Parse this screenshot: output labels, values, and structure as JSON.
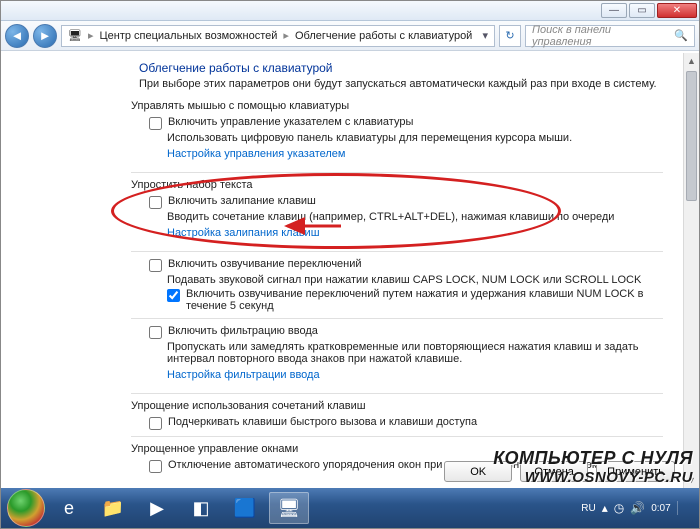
{
  "titlebar": {
    "min": "—",
    "max": "▭",
    "close": "✕"
  },
  "nav": {
    "back": "◄",
    "fwd": "►",
    "refresh": "↻",
    "crumb1": "Центр специальных возможностей",
    "crumb2": "Облегчение работы с клавиатурой",
    "search_placeholder": "Поиск в панели управления"
  },
  "page": {
    "title": "Облегчение работы с клавиатурой",
    "desc": "При выборе этих параметров они будут запускаться автоматически каждый раз при входе в систему."
  },
  "sec_mouse": {
    "head": "Управлять мышью с помощью клавиатуры",
    "chk1": "Включить управление указателем с клавиатуры",
    "note": "Использовать цифровую панель клавиатуры для перемещения курсора мыши.",
    "link": "Настройка управления указателем"
  },
  "sec_typing": {
    "head": "Упростить набор текста",
    "sticky_chk": "Включить залипание клавиш",
    "sticky_note": "Вводить сочетание клавиш (например, CTRL+ALT+DEL), нажимая клавиши по очереди",
    "sticky_link": "Настройка залипания клавиш",
    "toggle_chk": "Включить озвучивание переключений",
    "toggle_note": "Подавать звуковой сигнал при нажатии клавиш CAPS LOCK, NUM LOCK или SCROLL LOCK",
    "toggle_sub_chk": "Включить озвучивание переключений путем нажатия и удержания клавиши NUM LOCK в течение 5 секунд",
    "filter_chk": "Включить фильтрацию ввода",
    "filter_note": "Пропускать или замедлять кратковременные или повторяющиеся нажатия клавиш и задать интервал повторного ввода знаков при нажатой клавише.",
    "filter_link": "Настройка фильтрации ввода"
  },
  "sec_shortcuts": {
    "head": "Упрощение использования сочетаний клавиш",
    "chk": "Подчеркивать клавиши быстрого вызова и клавиши доступа"
  },
  "sec_windows": {
    "head": "Упрощенное управление окнами",
    "chk": "Отключение автоматического упорядочения окон при их перемещении к границе экрана"
  },
  "buttons": {
    "ok": "OK",
    "cancel": "Отмена",
    "apply": "Применить"
  },
  "tray": {
    "lang": "RU",
    "time": "0:07"
  },
  "watermark": {
    "l1": "КОМПЬЮТЕР С НУЛЯ",
    "l2": "WWW.OSNOVY-PC.RU"
  }
}
